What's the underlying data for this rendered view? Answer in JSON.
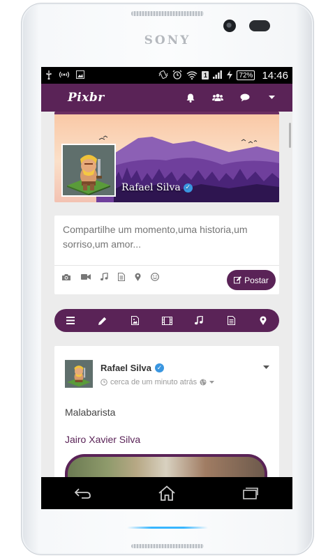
{
  "device": {
    "brand": "SONY"
  },
  "status_bar": {
    "battery": "72%",
    "time": "14:46",
    "sim_slot": "1"
  },
  "app_bar": {
    "logo": "Pixbr",
    "icons": [
      "bell-icon",
      "users-icon",
      "chat-icon",
      "caret-down-icon"
    ]
  },
  "profile": {
    "name": "Rafael Silva",
    "verified": true
  },
  "composer": {
    "placeholder": "Compartilhe um momento,uma historia,um sorriso,um amor...",
    "tools": [
      "camera-icon",
      "video-icon",
      "music-icon",
      "document-icon",
      "location-icon",
      "smile-icon"
    ],
    "post_label": "Postar"
  },
  "type_bar": {
    "items": [
      "menu-icon",
      "pencil-icon",
      "image-icon",
      "film-icon",
      "music-icon",
      "document-icon",
      "location-icon"
    ]
  },
  "post": {
    "author": "Rafael Silva",
    "timestamp": "cerca de um minuto atrás",
    "text": "Malabarista",
    "mention": "Jairo Xavier Silva"
  },
  "colors": {
    "primary": "#5a2357",
    "verified": "#3a96e0"
  }
}
